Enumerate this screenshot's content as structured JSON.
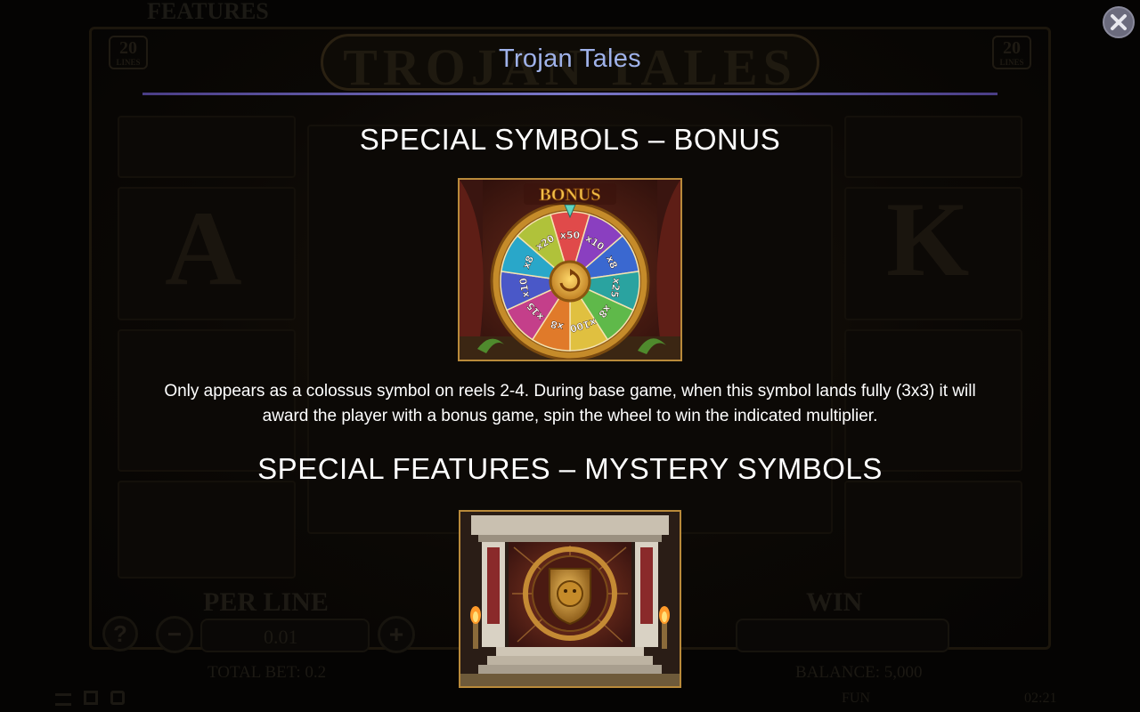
{
  "background": {
    "features_label": "FEATURES",
    "logo_text": "TROJAN TALES",
    "lines_left": "20",
    "lines_right": "20",
    "lines_word": "LINES",
    "per_line_label": "PER LINE",
    "per_line_value": "0.01",
    "win_label": "WIN",
    "total_bet": "TOTAL BET: 0.2",
    "balance": "BALANCE: 5,000",
    "fun_label": "FUN",
    "clock": "02:21",
    "help_glyph": "?",
    "minus_glyph": "−",
    "plus_glyph": "+",
    "reel_letters": [
      "A",
      "K"
    ]
  },
  "header": {
    "title": "Trojan Tales"
  },
  "close_button": {
    "icon": "close-icon"
  },
  "sections": [
    {
      "title": "SPECIAL SYMBOLS – BONUS",
      "image_word": "BONUS",
      "wheel_labels": [
        "x50",
        "x10",
        "x8",
        "x25",
        "x8",
        "x100",
        "x8",
        "x15",
        "x10",
        "x8",
        "x20"
      ],
      "description_line1": "Only appears as a colossus symbol on reels 2-4. During base game, when this symbol lands fully (3x3) it will",
      "description_line2": "award the player with a bonus game, spin the wheel to win the indicated multiplier."
    },
    {
      "title": "SPECIAL FEATURES – MYSTERY SYMBOLS"
    }
  ],
  "colors": {
    "title_color": "#9fb2ea",
    "header_line": "#7a78c9",
    "gold_border": "#b98a3a"
  }
}
